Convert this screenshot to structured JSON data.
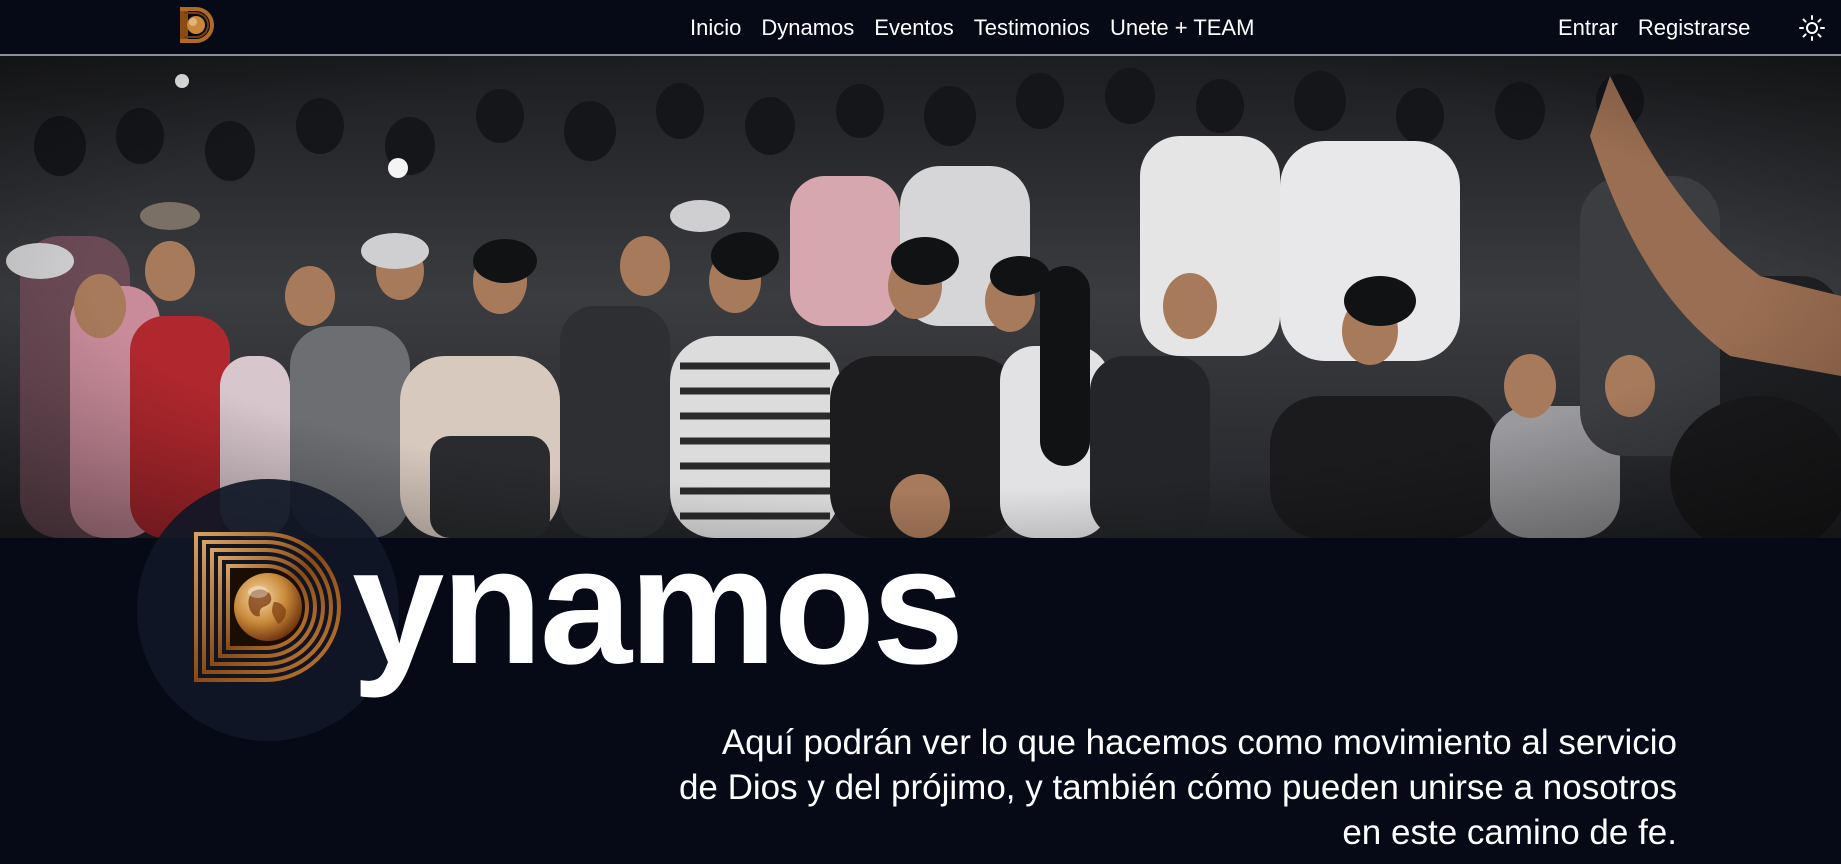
{
  "navbar": {
    "logo_icon": "dynamos-globe-logo-icon",
    "links": [
      {
        "label": "Inicio"
      },
      {
        "label": "Dynamos"
      },
      {
        "label": "Eventos"
      },
      {
        "label": "Testimonios"
      },
      {
        "label": "Unete + TEAM"
      }
    ],
    "auth": {
      "login_label": "Entrar",
      "register_label": "Registrarse"
    },
    "theme_toggle_icon": "sun-icon"
  },
  "hero": {
    "image_subject": "crowd-photo"
  },
  "brand": {
    "logo_icon": "dynamos-globe-logo-icon",
    "word": "ynamos"
  },
  "tagline": {
    "line1": "Aquí podrán ver lo que hacemos como movimiento al servicio",
    "line2": "de Dios y del prójimo, y también cómo pueden unirse a nosotros",
    "line3": "en este camino de fe."
  },
  "colors": {
    "background": "#050a16",
    "text": "#ffffff",
    "logo_gold": "#c8893a",
    "logo_frame": "#8a4a12"
  }
}
